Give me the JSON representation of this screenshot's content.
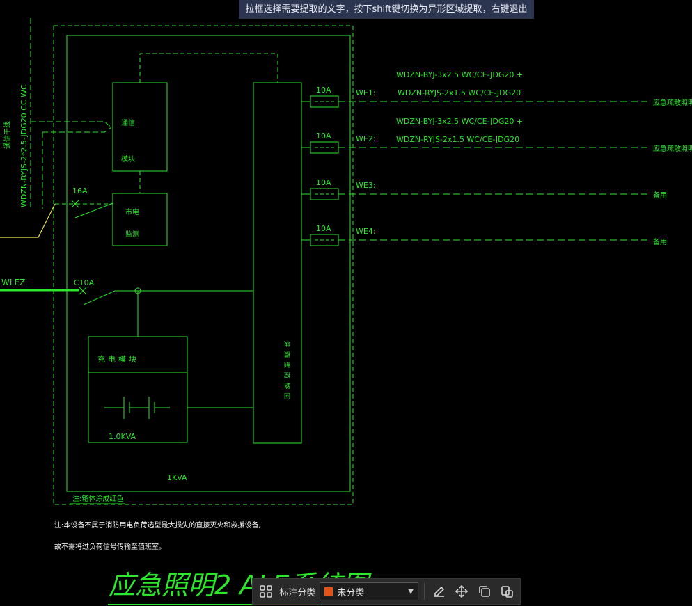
{
  "hint_bar": {
    "text": "拉框选择需要提取的文字，按下shift键切换为异形区域提取，右键退出"
  },
  "colors": {
    "line": "#2ee62e",
    "feed": "#e8e84a",
    "background": "#000000",
    "hint_bg": "#2c3550",
    "tag": "#e0531a"
  },
  "incoming": {
    "cable_label": "WDZN-RYJS-2*2.5-JDG20 CC WC",
    "signal_label": "通信干线",
    "breaker_rating": "16A",
    "main_breaker_rating": "C10A",
    "feeder_label": "WLEZ"
  },
  "modules": {
    "comm": {
      "line1": "通信",
      "line2": "模块"
    },
    "monitor": {
      "line1": "市电",
      "line2": "监测"
    },
    "charger": {
      "label": "充电模块",
      "battery_rating": "1.0KVA"
    },
    "control": {
      "label": "回路控制模块"
    }
  },
  "circuits": [
    {
      "id": "WE1:",
      "rating": "10A",
      "cable1": "WDZN-BYJ-3x2.5  WC/CE-JDG20 +",
      "cable2": "WDZN-RYJS-2x1.5  WC/CE-JDG20",
      "load": "应急疏散照明"
    },
    {
      "id": "WE2:",
      "rating": "10A",
      "cable1": "WDZN-BYJ-3x2.5  WC/CE-JDG20 +",
      "cable2": "WDZN-RYJS-2x1.5  WC/CE-JDG20",
      "load": "应急疏散照明"
    },
    {
      "id": "WE3:",
      "rating": "10A",
      "cable1": "",
      "cable2": "",
      "load": "备用"
    },
    {
      "id": "WE4:",
      "rating": "10A",
      "cable1": "",
      "cable2": "",
      "load": "备用"
    }
  ],
  "panel": {
    "capacity": "1KVA",
    "note": "注:箱体涂成红色"
  },
  "notes": {
    "line1": "注:本设备不属于消防用电负荷选型最大损失的直接灭火和救援设备,",
    "line2": "故不需将过负荷信号传输至值班室。"
  },
  "drawing_title": "应急照明2 ALE系统图",
  "toolbar": {
    "grid_icon": "grid-icon",
    "label": "标注分类",
    "select_value": "未分类",
    "icons": [
      "edit-icon",
      "move-icon",
      "copy-icon",
      "paste-icon"
    ]
  }
}
